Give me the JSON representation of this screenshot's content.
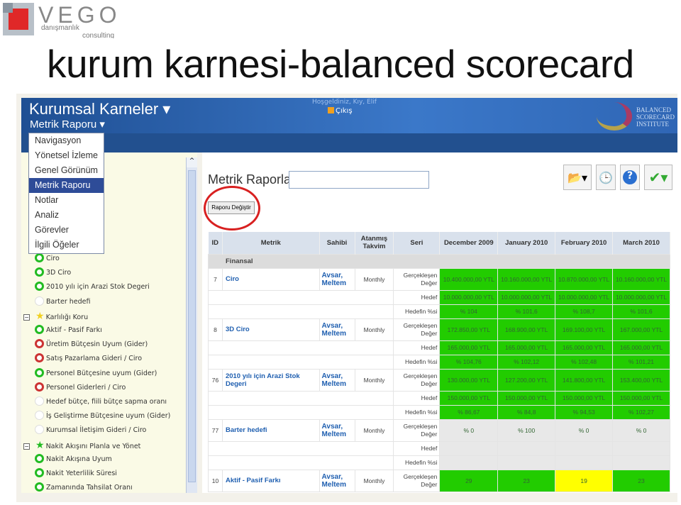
{
  "slide": {
    "title": "kurum karnesi-balanced scorecard",
    "logo": {
      "brand": "VEGO",
      "line1": "danışmanlık",
      "line2": "consulting"
    }
  },
  "colors": {
    "good": "#22cc00",
    "warning": "#ffff00",
    "neutral": "#e8e8e8",
    "header_blue": "#22508f",
    "menu_selected": "#2e4c98"
  },
  "app": {
    "title": "Kurumsal Karneler",
    "subtitle": "Metrik Raporu",
    "welcome": "Hoşgeldiniz, Kıy, Elif",
    "logout": "Çıkış",
    "partner_logo": "BALANCED SCORECARD INSTITUTE"
  },
  "menu": {
    "items": [
      "Navigasyon",
      "Yönetsel İzleme",
      "Genel Görünüm",
      "Metrik Raporu",
      "Notlar",
      "Analiz",
      "Görevler",
      "İlgili Öğeler"
    ],
    "selected": "Metrik Raporu"
  },
  "tree": [
    {
      "label": "Ciro",
      "status": "green"
    },
    {
      "label": "3D Ciro",
      "status": "green"
    },
    {
      "label": "2010 yılı için Arazi Stok Degeri",
      "status": "green"
    },
    {
      "label": "Barter hedefi",
      "status": "none"
    },
    {
      "label": "Karlılığı Koru",
      "group": true,
      "star": "yellow"
    },
    {
      "label": "Aktif - Pasif Farkı",
      "status": "green"
    },
    {
      "label": "Üretim Bütçesin Uyum (Gider)",
      "status": "red"
    },
    {
      "label": "Satış Pazarlama Gideri / Ciro",
      "status": "red"
    },
    {
      "label": "Personel  Bütçesine uyum (Gider)",
      "status": "green"
    },
    {
      "label": "Personel Giderleri / Ciro",
      "status": "red"
    },
    {
      "label": "Hedef bütçe, fiili bütçe sapma oranı",
      "status": "none"
    },
    {
      "label": "İş Geliştirme Bütçesine uyum (Gider)",
      "status": "none"
    },
    {
      "label": "Kurumsal İletişim Gideri / Ciro",
      "status": "none"
    },
    {
      "label": "Nakit Akışını Planla ve Yönet",
      "group": true,
      "star": "green"
    },
    {
      "label": "Nakit Akışına Uyum",
      "status": "green"
    },
    {
      "label": "Nakit Yeterlilik Süresi",
      "status": "green"
    },
    {
      "label": "Zamanında Tahsilat Oranı",
      "status": "green"
    }
  ],
  "report": {
    "heading": "Metrik Raporları",
    "name_value": "",
    "change_button": "Raporu Değiştir"
  },
  "toolbar": [
    "export-icon",
    "schedule-icon",
    "help-icon",
    "approve-icon"
  ],
  "table": {
    "headers": [
      "ID",
      "Metrik",
      "Sahibi",
      "Atanmış Takvim",
      "Seri",
      "December 2009",
      "January 2010",
      "February 2010",
      "March 2010"
    ],
    "category": "Finansal",
    "series_labels": [
      "Gerçekleşen Değer",
      "Hedef",
      "Hedefin %si"
    ],
    "rows": [
      {
        "id": "7",
        "metric": "Ciro",
        "owner": "Avsar, Meltem",
        "schedule": "Monthly",
        "values": [
          [
            "10.400.000,00 YTL",
            "10.160.000,00 YTL",
            "10.870.000,00 YTL",
            "10.160.000,00 YTL"
          ],
          [
            "10.000.000,00 YTL",
            "10.000.000,00 YTL",
            "10.000.000,00 YTL",
            "10.000.000,00 YTL"
          ],
          [
            "% 104",
            "% 101,6",
            "% 108,7",
            "% 101,6"
          ]
        ],
        "status": [
          [
            "g",
            "g",
            "g",
            "g"
          ],
          [
            "g",
            "g",
            "g",
            "g"
          ],
          [
            "g",
            "g",
            "g",
            "g"
          ]
        ]
      },
      {
        "id": "8",
        "metric": "3D Ciro",
        "owner": "Avsar, Meltem",
        "schedule": "Monthly",
        "values": [
          [
            "172.850,00 YTL",
            "168.900,00 YTL",
            "169.100,00 YTL",
            "167.000,00 YTL"
          ],
          [
            "165.000,00 YTL",
            "165.000,00 YTL",
            "165.000,00 YTL",
            "165.000,00 YTL"
          ],
          [
            "% 104,76",
            "% 102,12",
            "% 102,48",
            "% 101,21"
          ]
        ],
        "status": [
          [
            "g",
            "g",
            "g",
            "g"
          ],
          [
            "g",
            "g",
            "g",
            "g"
          ],
          [
            "g",
            "g",
            "g",
            "g"
          ]
        ]
      },
      {
        "id": "76",
        "metric": "2010 yılı için Arazi Stok Degeri",
        "owner": "Avsar, Meltem",
        "schedule": "Monthly",
        "values": [
          [
            "130.000,00 YTL",
            "127.200,00 YTL",
            "141.800,00 YTL",
            "153.400,00 YTL"
          ],
          [
            "150.000,00 YTL",
            "150.000,00 YTL",
            "150.000,00 YTL",
            "150.000,00 YTL"
          ],
          [
            "% 86,67",
            "% 84,8",
            "% 94,53",
            "% 102,27"
          ]
        ],
        "status": [
          [
            "g",
            "g",
            "g",
            "g"
          ],
          [
            "g",
            "g",
            "g",
            "g"
          ],
          [
            "g",
            "g",
            "g",
            "g"
          ]
        ]
      },
      {
        "id": "77",
        "metric": "Barter hedefi",
        "owner": "Avsar, Meltem",
        "schedule": "Monthly",
        "values": [
          [
            "% 0",
            "% 100",
            "% 0",
            "% 0"
          ],
          [
            "",
            "",
            "",
            ""
          ],
          [
            "",
            "",
            "",
            ""
          ]
        ],
        "status": [
          [
            "n",
            "n",
            "n",
            "n"
          ],
          [
            "n",
            "n",
            "n",
            "n"
          ],
          [
            "n",
            "n",
            "n",
            "n"
          ]
        ]
      },
      {
        "id": "10",
        "metric": "Aktif - Pasif Farkı",
        "owner": "Avsar, Meltem",
        "schedule": "Monthly",
        "values": [
          [
            "29",
            "23",
            "19",
            "23"
          ]
        ],
        "status": [
          [
            "g",
            "g",
            "y",
            "g"
          ]
        ]
      }
    ]
  }
}
